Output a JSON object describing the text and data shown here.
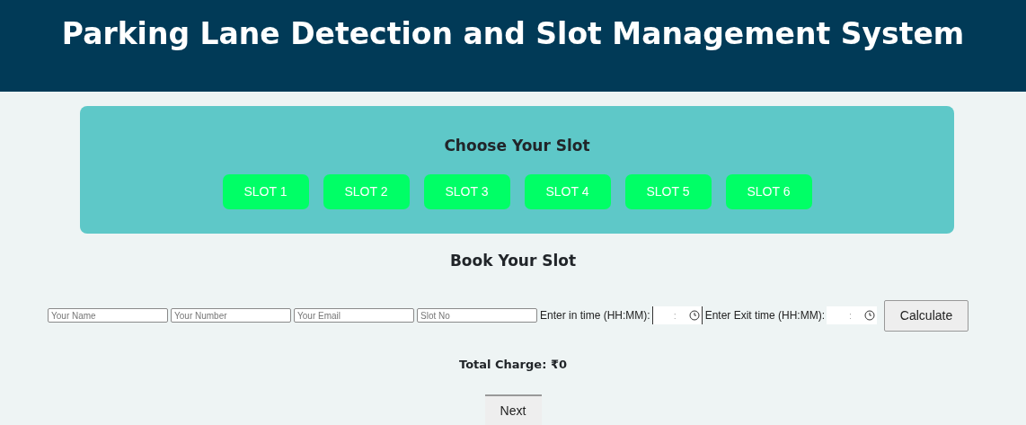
{
  "header": {
    "title": "Parking Lane Detection and Slot Management System"
  },
  "slot_panel": {
    "title": "Choose Your Slot",
    "slots": [
      "SLOT 1",
      "SLOT 2",
      "SLOT 3",
      "SLOT 4",
      "SLOT 5",
      "SLOT 6"
    ]
  },
  "booking": {
    "title": "Book Your Slot",
    "fields": [
      {
        "placeholder": "Your Name"
      },
      {
        "placeholder": "Your Number"
      },
      {
        "placeholder": "Your Email"
      },
      {
        "placeholder": "Slot No"
      }
    ],
    "time_fields": [
      {
        "label": "Enter in time (HH:MM):",
        "separator": ":"
      },
      {
        "label": "Enter Exit time (HH:MM):",
        "separator": ":"
      }
    ],
    "calculate_button": "Calculate",
    "total_charge": "Total Charge: ₹0",
    "next_button": "Next"
  }
}
